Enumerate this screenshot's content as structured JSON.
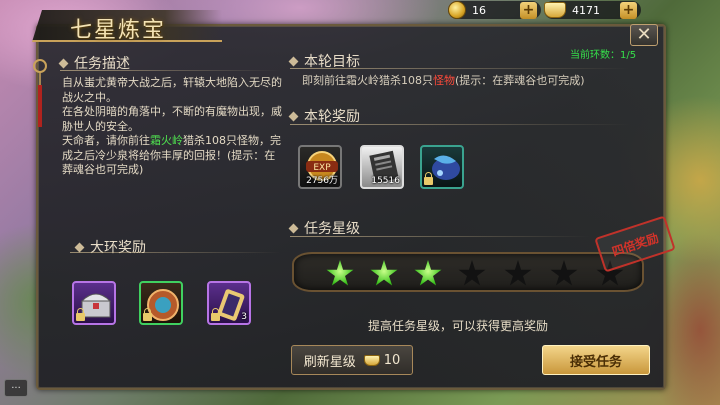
{
  "resources": {
    "coins": "16",
    "ingots": "4171"
  },
  "window": {
    "title": "七星炼宝",
    "close_label": "✕"
  },
  "task_desc": {
    "heading": "任务描述",
    "line1": "自从蚩尤黄帝大战之后，轩辕大地陷入无尽的战火之中。",
    "line2": "在各处阴暗的角落中，不断的有魔物出现，威胁世人的安全。",
    "line3a": "天命者，请你前往",
    "line3_place": "霜火岭",
    "line3b": "猎杀108只怪物，完成之后冷少泉将给你丰厚的回报！(提示：在葬魂谷也可完成)"
  },
  "round_goal": {
    "heading": "本轮目标",
    "text_a": "即刻前往霜火岭猎杀108只",
    "text_target": "怪物",
    "text_b": "(提示：在葬魂谷也可完成)",
    "round_count": "当前环数：1/5"
  },
  "round_rewards": {
    "heading": "本轮奖励",
    "items": [
      {
        "icon": "exp-icon",
        "qty": "2756万"
      },
      {
        "icon": "scroll-icon",
        "qty": "15516"
      },
      {
        "icon": "spirit-stone-icon",
        "qty": ""
      }
    ]
  },
  "task_stars": {
    "heading": "任务星级",
    "lit": 3,
    "total": 7,
    "stamp": "四倍奖励",
    "hint": "提高任务星级，可以获得更高奖励"
  },
  "ring_rewards": {
    "heading": "大环奖励",
    "items": [
      {
        "icon": "treasure-chest-icon",
        "qty": ""
      },
      {
        "icon": "jade-token-icon",
        "qty": ""
      },
      {
        "icon": "talisman-icon",
        "qty": "3"
      }
    ]
  },
  "actions": {
    "refresh_label": "刷新星级",
    "refresh_cost": "10",
    "accept_label": "接受任务"
  },
  "chat": {
    "label": "···"
  },
  "colors": {
    "star_on": "#3cc21e",
    "accent_gold": "#c9a25a",
    "highlight_green": "#4fe04f",
    "highlight_red": "#ff4a3a"
  }
}
